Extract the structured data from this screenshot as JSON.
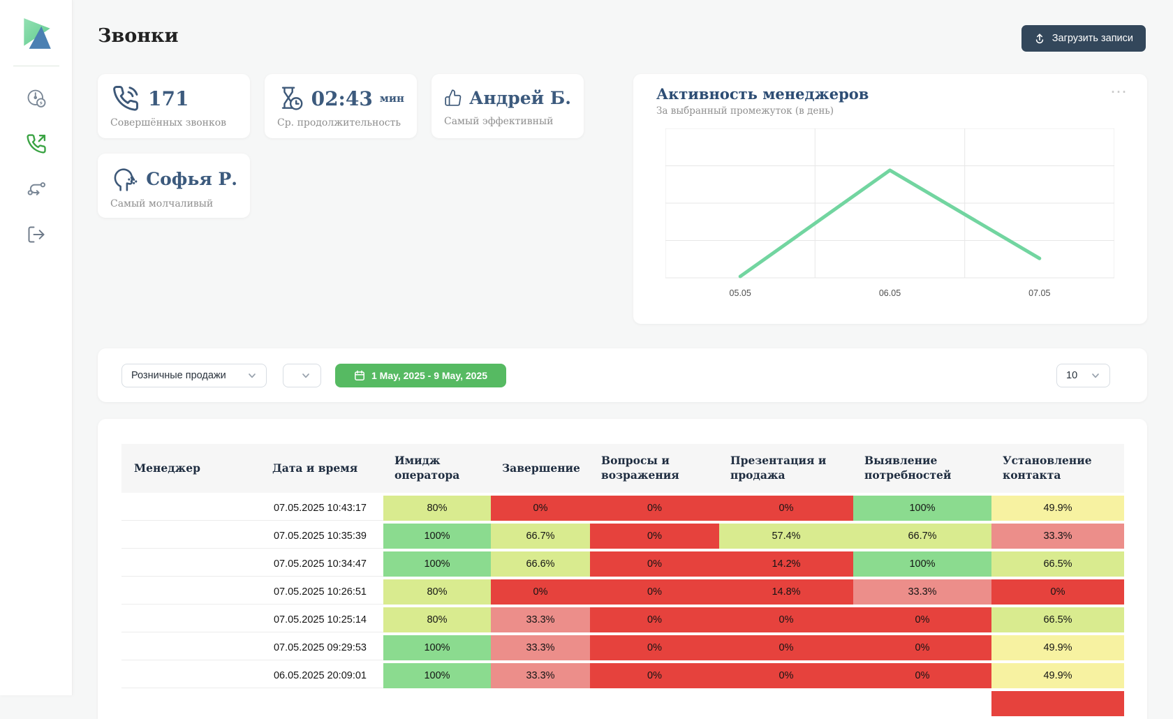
{
  "page": {
    "title": "Звонки",
    "upload_button_label": "Загрузить записи"
  },
  "sidebar": {
    "items": [
      {
        "icon": "gauge-icon",
        "active": false
      },
      {
        "icon": "phone-outgoing-icon",
        "active": true
      },
      {
        "icon": "route-icon",
        "active": false
      },
      {
        "icon": "logout-icon",
        "active": false
      }
    ]
  },
  "stats": [
    {
      "icon": "phone-icon",
      "value": "171",
      "label": "Совершённых звонков"
    },
    {
      "icon": "hourglass-clock-icon",
      "value": "02:43",
      "unit": "мин",
      "label": "Ср. продолжительность"
    },
    {
      "icon": "thumbs-up-icon",
      "value": "Андрей Б.",
      "label": "Самый эффективный"
    },
    {
      "icon": "silent-head-icon",
      "value": "Софья Р.",
      "label": "Самый молчаливый"
    }
  ],
  "chart": {
    "title": "Активность менеджеров",
    "subtitle": "За выбранный промежуток (в день)",
    "menu_icon": "ellipsis-icon"
  },
  "chart_data": {
    "type": "line",
    "x": [
      "05.05",
      "06.05",
      "07.05"
    ],
    "series": [
      {
        "name": "Активность менеджеров",
        "values": [
          0,
          72,
          13
        ]
      }
    ],
    "ylim": [
      0,
      100
    ],
    "y_axis_labels_visible": false,
    "grid": true,
    "line_color": "#72d5a0",
    "grid_columns": 3,
    "grid_rows": 4
  },
  "filters": {
    "team_select_value": "Розничные продажи",
    "secondary_select_value": "",
    "date_range_label": "1 May, 2025 - 9 May, 2025",
    "page_size_value": "10"
  },
  "table": {
    "columns": [
      "Менеджер",
      "Дата и время",
      "Имидж оператора",
      "Завершение",
      "Вопросы и возражения",
      "Презентация и продажа",
      "Выявление потребностей",
      "Установление контакта"
    ],
    "rows": [
      {
        "manager": "",
        "datetime": "07.05.2025 10:43:17",
        "partial": false,
        "cells": [
          {
            "v": "80%",
            "c": "lime"
          },
          {
            "v": "0%",
            "c": "red"
          },
          {
            "v": "0%",
            "c": "red"
          },
          {
            "v": "0%",
            "c": "red"
          },
          {
            "v": "100%",
            "c": "green"
          },
          {
            "v": "49.9%",
            "c": "yellow"
          }
        ]
      },
      {
        "manager": "",
        "datetime": "07.05.2025 10:35:39",
        "partial": false,
        "cells": [
          {
            "v": "100%",
            "c": "green"
          },
          {
            "v": "66.7%",
            "c": "lime"
          },
          {
            "v": "0%",
            "c": "red"
          },
          {
            "v": "57.4%",
            "c": "lime"
          },
          {
            "v": "66.7%",
            "c": "lime"
          },
          {
            "v": "33.3%",
            "c": "pink"
          }
        ]
      },
      {
        "manager": "",
        "datetime": "07.05.2025 10:34:47",
        "partial": false,
        "cells": [
          {
            "v": "100%",
            "c": "green"
          },
          {
            "v": "66.6%",
            "c": "lime"
          },
          {
            "v": "0%",
            "c": "red"
          },
          {
            "v": "14.2%",
            "c": "red"
          },
          {
            "v": "100%",
            "c": "green"
          },
          {
            "v": "66.5%",
            "c": "lime"
          }
        ]
      },
      {
        "manager": "",
        "datetime": "07.05.2025 10:26:51",
        "partial": false,
        "cells": [
          {
            "v": "80%",
            "c": "lime"
          },
          {
            "v": "0%",
            "c": "red"
          },
          {
            "v": "0%",
            "c": "red"
          },
          {
            "v": "14.8%",
            "c": "red"
          },
          {
            "v": "33.3%",
            "c": "pink"
          },
          {
            "v": "0%",
            "c": "red"
          }
        ]
      },
      {
        "manager": "",
        "datetime": "07.05.2025 10:25:14",
        "partial": false,
        "cells": [
          {
            "v": "80%",
            "c": "lime"
          },
          {
            "v": "33.3%",
            "c": "pink"
          },
          {
            "v": "0%",
            "c": "red"
          },
          {
            "v": "0%",
            "c": "red"
          },
          {
            "v": "0%",
            "c": "red"
          },
          {
            "v": "66.5%",
            "c": "lime"
          }
        ]
      },
      {
        "manager": "",
        "datetime": "07.05.2025 09:29:53",
        "partial": false,
        "cells": [
          {
            "v": "100%",
            "c": "green"
          },
          {
            "v": "33.3%",
            "c": "pink"
          },
          {
            "v": "0%",
            "c": "red"
          },
          {
            "v": "0%",
            "c": "red"
          },
          {
            "v": "0%",
            "c": "red"
          },
          {
            "v": "49.9%",
            "c": "yellow"
          }
        ]
      },
      {
        "manager": "",
        "datetime": "06.05.2025 20:09:01",
        "partial": false,
        "cells": [
          {
            "v": "100%",
            "c": "green"
          },
          {
            "v": "33.3%",
            "c": "pink"
          },
          {
            "v": "0%",
            "c": "red"
          },
          {
            "v": "0%",
            "c": "red"
          },
          {
            "v": "0%",
            "c": "red"
          },
          {
            "v": "49.9%",
            "c": "yellow"
          }
        ]
      },
      {
        "manager": "",
        "datetime": "",
        "partial": true,
        "cells": [
          {
            "v": "",
            "c": "none"
          },
          {
            "v": "",
            "c": "none"
          },
          {
            "v": "",
            "c": "none"
          },
          {
            "v": "",
            "c": "none"
          },
          {
            "v": "",
            "c": "none"
          },
          {
            "v": "",
            "c": "red"
          }
        ]
      }
    ]
  },
  "colors": {
    "page_background": "#f6f7f7",
    "button_navy": "#33475b",
    "stat_navy": "#3c5a7d",
    "chart_title_navy": "#2d4d74",
    "accent_green": "#56ba62",
    "line_green": "#72d5a0",
    "sidebar_active_green": "#3aa343",
    "cell_levels": {
      "red": "#e6423d",
      "pink": "#ec8e8a",
      "lime": "#d9eb8f",
      "green": "#8bdb8f",
      "yellow": "#f7f2a1",
      "none": "transparent"
    }
  }
}
